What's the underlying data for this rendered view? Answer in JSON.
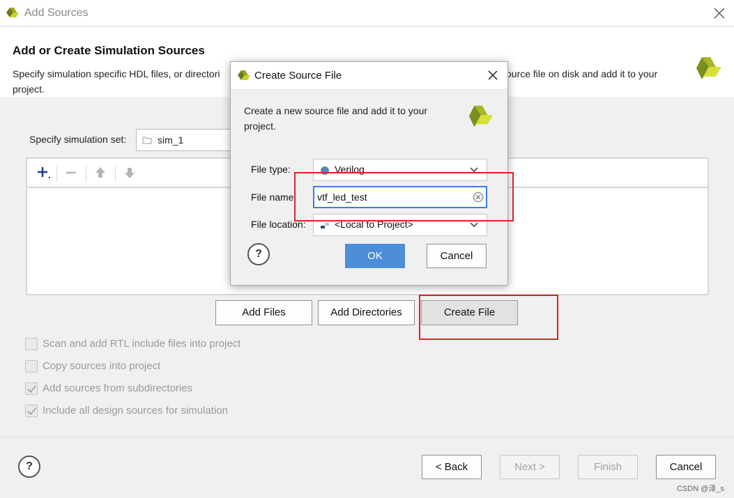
{
  "window": {
    "title": "Add Sources",
    "logo_icon": "xilinx-logo-icon",
    "close_icon": "close-icon"
  },
  "page": {
    "heading": "Add or Create Simulation Sources",
    "desc_left": "Specify simulation specific HDL files, or directori",
    "desc_right": "ource file on disk and add it to your",
    "desc_line2": "project."
  },
  "simset": {
    "label": "Specify simulation set:",
    "value": "sim_1"
  },
  "toolbar": {
    "add_icon": "plus-icon",
    "remove_icon": "minus-icon",
    "up_icon": "arrow-up-icon",
    "down_icon": "arrow-down-icon"
  },
  "actions": {
    "add_files": "Add Files",
    "add_directories": "Add Directories",
    "create_file": "Create File"
  },
  "options": [
    {
      "label": "Scan and add RTL include files into project",
      "checked": false
    },
    {
      "label": "Copy sources into project",
      "checked": false
    },
    {
      "label": "Add sources from subdirectories",
      "checked": true
    },
    {
      "label": "Include all design sources for simulation",
      "checked": true
    }
  ],
  "footer": {
    "help": "?",
    "back": "< Back",
    "next": "Next >",
    "finish": "Finish",
    "cancel": "Cancel"
  },
  "watermark": "CSDN @泽_s",
  "dialog": {
    "title": "Create Source File",
    "desc": "Create a new source file and add it to your project.",
    "file_type_label": "File type:",
    "file_type_value": "Verilog",
    "file_name_label": "File name:",
    "file_name_value": "vtf_led_test",
    "file_location_label": "File location:",
    "file_location_value": "<Local to Project>",
    "help": "?",
    "ok": "OK",
    "cancel": "Cancel"
  },
  "colors": {
    "accent": "#4d8ed9",
    "highlight": "#e0202a",
    "verilog_dot": "#4f8cab"
  }
}
